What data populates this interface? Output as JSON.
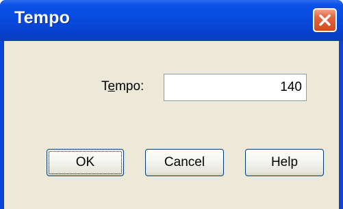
{
  "window": {
    "title": "Tempo"
  },
  "form": {
    "tempo_label_pre": "T",
    "tempo_label_mnemonic": "e",
    "tempo_label_post": "mpo:",
    "tempo_value": "140"
  },
  "buttons": {
    "ok": "OK",
    "cancel": "Cancel",
    "help": "Help"
  },
  "colors": {
    "titlebar": "#0748db",
    "close": "#d44a22",
    "client": "#ece9d8"
  },
  "icons": {
    "close": "close-icon"
  }
}
